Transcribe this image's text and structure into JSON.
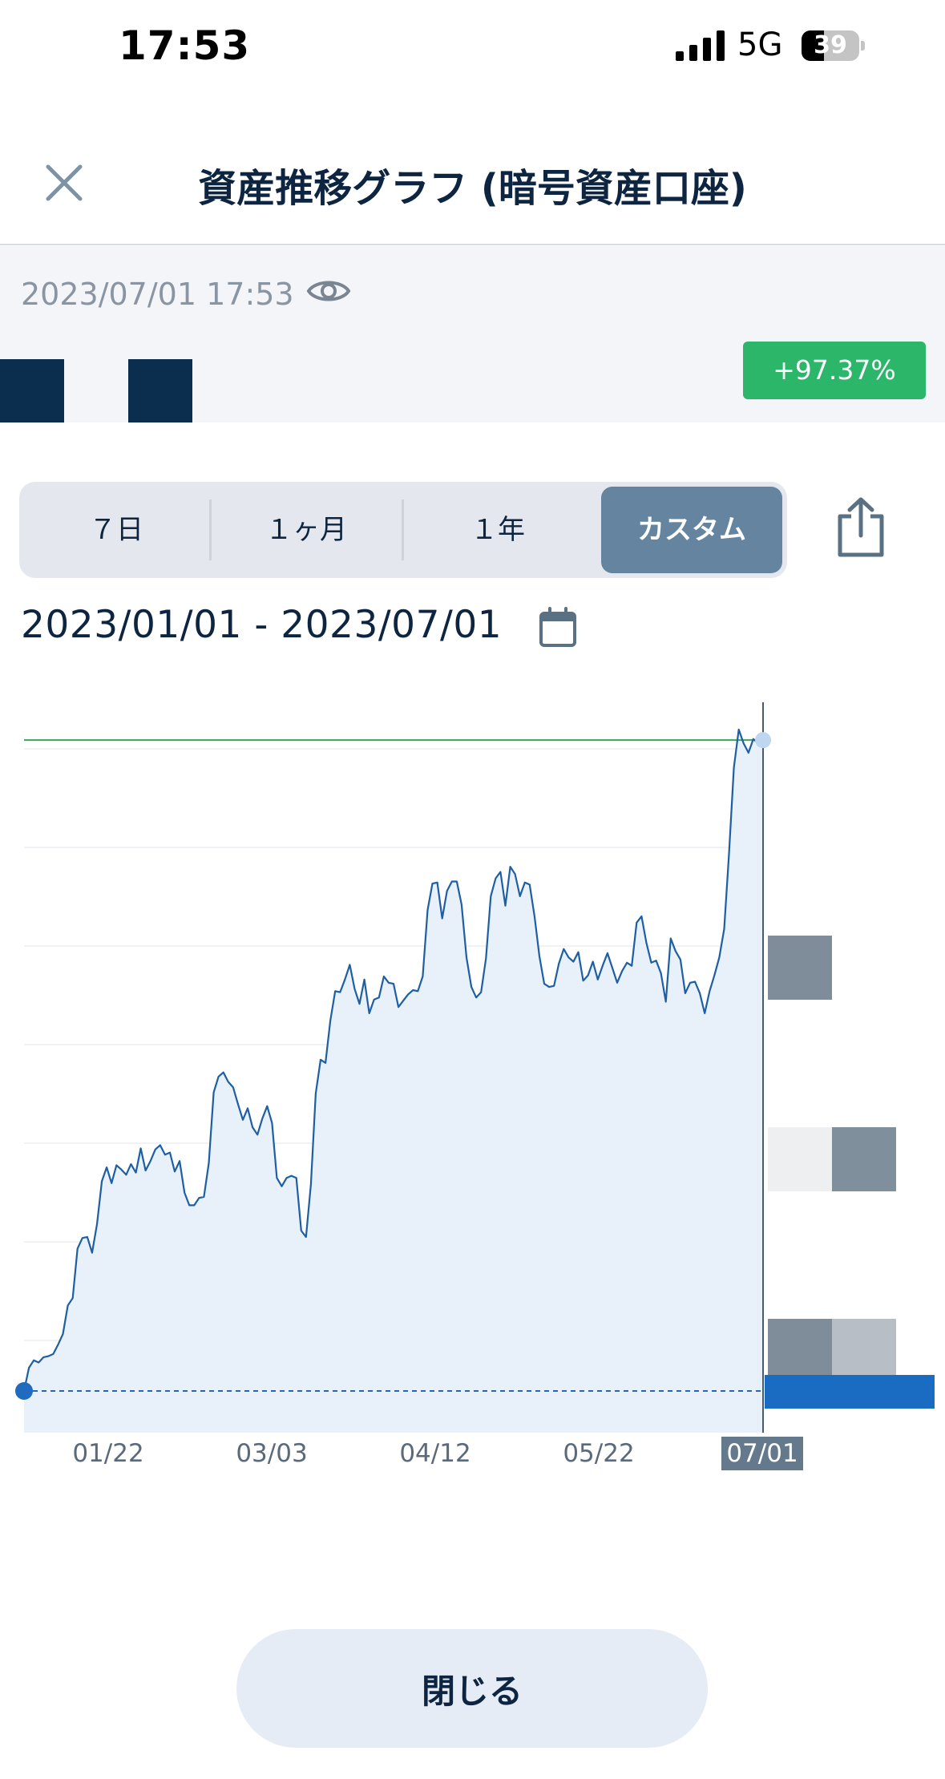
{
  "status_bar": {
    "time": "17:53",
    "network": "5G",
    "battery": "39",
    "battery_level": 0.39
  },
  "header": {
    "title": "資産推移グラフ (暗号資産口座)"
  },
  "summary": {
    "timestamp": "2023/07/01 17:53",
    "change": "+97.37%",
    "change_color": "#2bb66a"
  },
  "period_tabs": [
    {
      "label": "７日",
      "active": false
    },
    {
      "label": "１ヶ月",
      "active": false
    },
    {
      "label": "１年",
      "active": false
    },
    {
      "label": "カスタム",
      "active": true
    }
  ],
  "date_range": "2023/01/01 - 2023/07/01",
  "chart_data": {
    "type": "area",
    "x_tick_labels": [
      "01/22",
      "03/03",
      "04/12",
      "05/22",
      "07/01"
    ],
    "selected_tick": "07/01",
    "series": [
      {
        "color": "#1e5fa3",
        "values": [
          0,
          2.2,
          2.9,
          2.7,
          3.2,
          3.3,
          3.5,
          4.4,
          5.4,
          8.1,
          8.8,
          13.5,
          14.5,
          14.6,
          13.1,
          15.8,
          19.9,
          21.2,
          19.7,
          21.4,
          21.0,
          20.5,
          21.5,
          20.7,
          23.0,
          20.9,
          21.8,
          22.9,
          23.3,
          22.4,
          22.6,
          20.8,
          21.8,
          18.8,
          17.6,
          17.6,
          18.3,
          18.4,
          21.6,
          28.3,
          29.8,
          30.2,
          29.3,
          28.8,
          27.2,
          25.7,
          26.8,
          25.0,
          24.3,
          25.8,
          27.0,
          25.4,
          20.2,
          19.4,
          20.2,
          20.4,
          20.2,
          15.2,
          14.6,
          19.6,
          28.2,
          31.4,
          31.1,
          35.1,
          37.9,
          37.8,
          39.0,
          40.4,
          38.1,
          36.7,
          39.0,
          35.8,
          37.1,
          37.3,
          39.3,
          38.7,
          38.6,
          36.4,
          37.0,
          37.6,
          38.0,
          37.9,
          39.3,
          45.6,
          48.1,
          48.2,
          44.8,
          47.4,
          48.3,
          48.3,
          46.1,
          41.1,
          38.3,
          37.3,
          37.8,
          41.0,
          46.9,
          48.6,
          49.2,
          46.0,
          49.7,
          49.0,
          46.9,
          48.2,
          48.0,
          45.0,
          41.2,
          38.6,
          38.3,
          38.4,
          40.5,
          41.9,
          41.1,
          40.7,
          41.6,
          38.9,
          39.4,
          40.7,
          39.0,
          40.3,
          41.5,
          40.1,
          38.7,
          39.8,
          40.6,
          40.3,
          44.4,
          45.0,
          42.5,
          40.6,
          40.8,
          39.6,
          36.9,
          42.9,
          41.7,
          40.9,
          37.7,
          38.7,
          38.8,
          37.7,
          35.8,
          37.9,
          39.4,
          41.1,
          43.8,
          50.9,
          59.1,
          62.7,
          61.4,
          60.5,
          61.8,
          61.4,
          61.7
        ]
      }
    ],
    "baseline_value": 0,
    "reference_line": 61.7,
    "area_fill": "#e8f1fa",
    "baseline_color": "#2766b0",
    "reference_color": "#3aa55a",
    "grid": true
  },
  "footer": {
    "close_label": "閉じる"
  }
}
